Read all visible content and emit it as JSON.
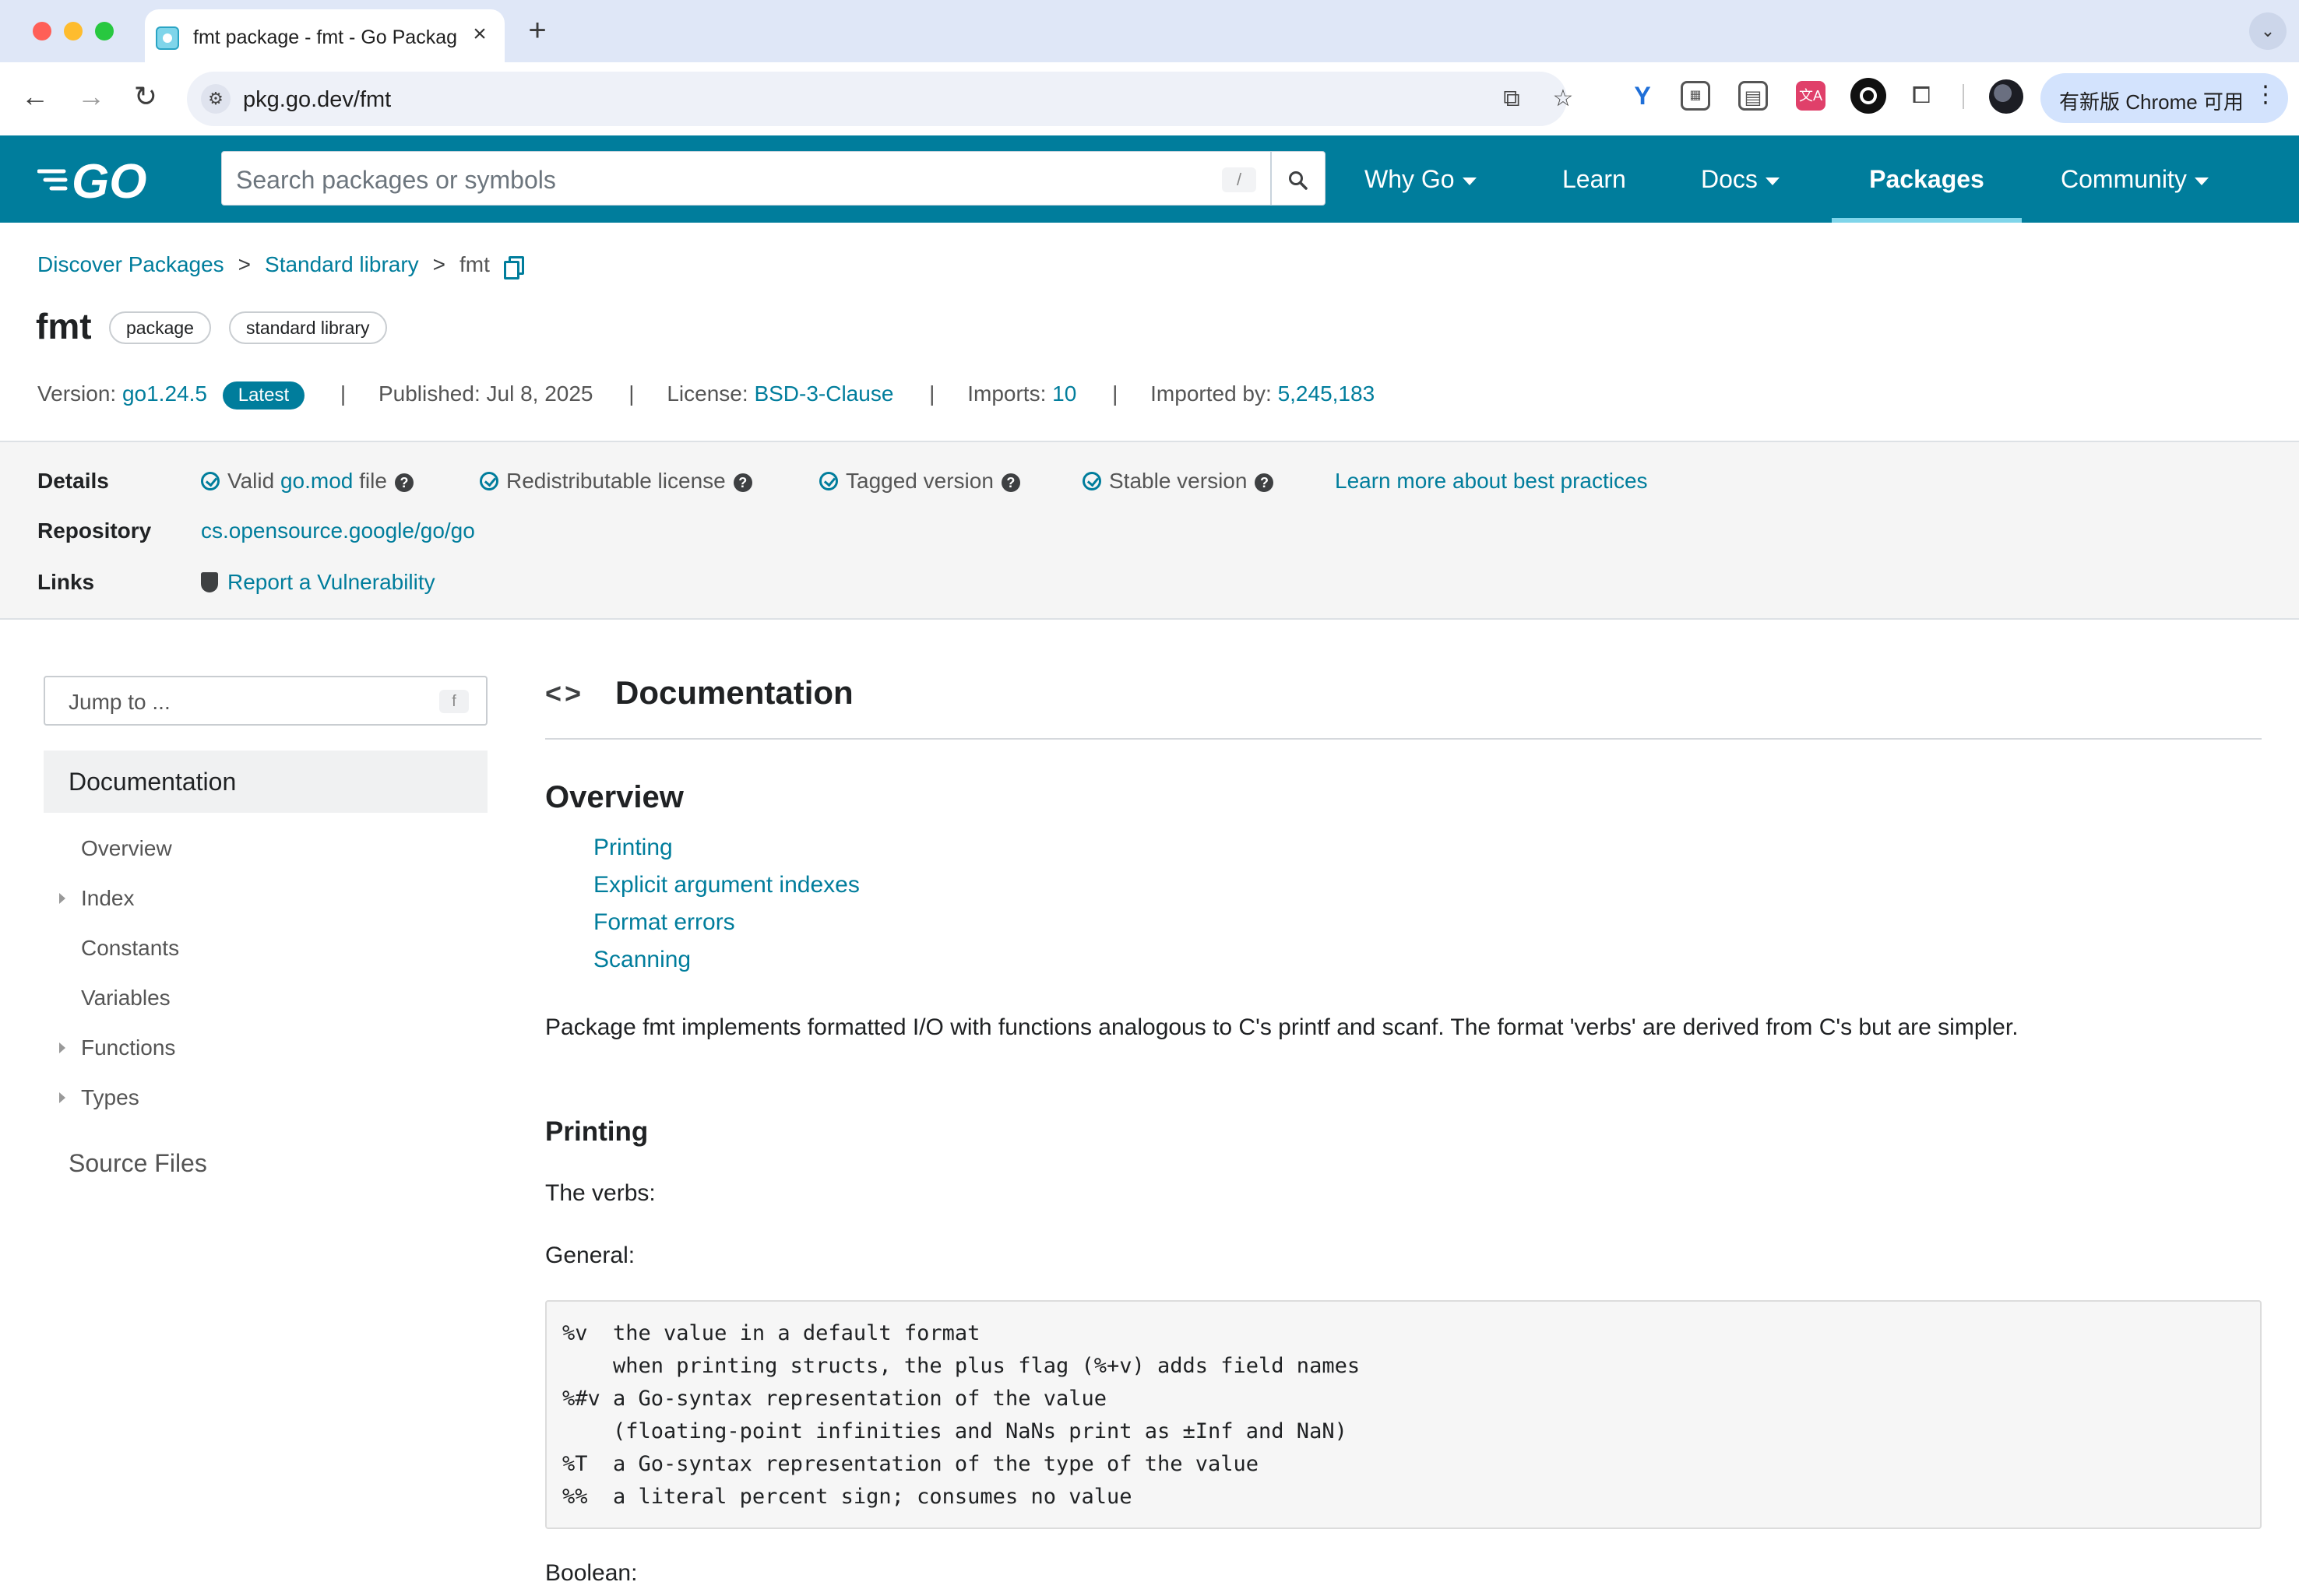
{
  "browser": {
    "tab_title": "fmt package - fmt - Go Packages",
    "tab_close": "×",
    "new_tab": "+",
    "tab_menu": "⌄",
    "url": "pkg.go.dev/fmt",
    "update_button": "有新版 Chrome 可用",
    "update_more": "⋮",
    "ext4_label": "文A",
    "nav_back": "←",
    "nav_forward": "→",
    "nav_reload": "↻",
    "translate_icon": "⧉",
    "star_icon": "☆"
  },
  "header": {
    "logo_text": "GO",
    "search_placeholder": "Search packages or symbols",
    "search_shortcut": "/",
    "nav": {
      "why_go": "Why Go",
      "learn": "Learn",
      "docs": "Docs",
      "packages": "Packages",
      "community": "Community"
    },
    "accent_color": "#007d9c"
  },
  "breadcrumb": {
    "discover": "Discover Packages",
    "stdlib": "Standard library",
    "current": "fmt",
    "separator": ">"
  },
  "package": {
    "name": "fmt",
    "pills": [
      "package",
      "standard library"
    ],
    "version_label": "Version:",
    "version": "go1.24.5",
    "latest_badge": "Latest",
    "published_label": "Published:",
    "published": "Jul 8, 2025",
    "license_label": "License:",
    "license": "BSD-3-Clause",
    "imports_label": "Imports:",
    "imports": "10",
    "imported_by_label": "Imported by:",
    "imported_by": "5,245,183",
    "separator": "|"
  },
  "details": {
    "details_label": "Details",
    "repository_label": "Repository",
    "links_label": "Links",
    "valid_prefix": "Valid",
    "valid_link": "go.mod",
    "valid_suffix": "file",
    "redistributable": "Redistributable license",
    "tagged": "Tagged version",
    "stable": "Stable version",
    "learn_more": "Learn more about best practices",
    "repository": "cs.opensource.google/go/go",
    "report_vuln": "Report a Vulnerability",
    "help": "?"
  },
  "sidebar": {
    "jump_placeholder": "Jump to ...",
    "jump_shortcut": "f",
    "documentation": "Documentation",
    "items": [
      "Overview",
      "Index",
      "Constants",
      "Variables",
      "Functions",
      "Types"
    ],
    "source_files": "Source Files"
  },
  "main": {
    "doc_icon": "<>",
    "doc_title": "Documentation",
    "overview_heading": "Overview",
    "toc": [
      "Printing",
      "Explicit argument indexes",
      "Format errors",
      "Scanning"
    ],
    "intro": "Package fmt implements formatted I/O with functions analogous to C's printf and scanf. The format 'verbs' are derived from C's but are simpler.",
    "printing_heading": "Printing",
    "verbs_label": "The verbs:",
    "general_label": "General:",
    "code_lines": [
      "%v  the value in a default format",
      "    when printing structs, the plus flag (%+v) adds field names",
      "%#v a Go-syntax representation of the value",
      "    (floating-point infinities and NaNs print as ±Inf and NaN)",
      "%T  a Go-syntax representation of the type of the value",
      "%%  a literal percent sign; consumes no value"
    ],
    "boolean_label": "Boolean:"
  }
}
